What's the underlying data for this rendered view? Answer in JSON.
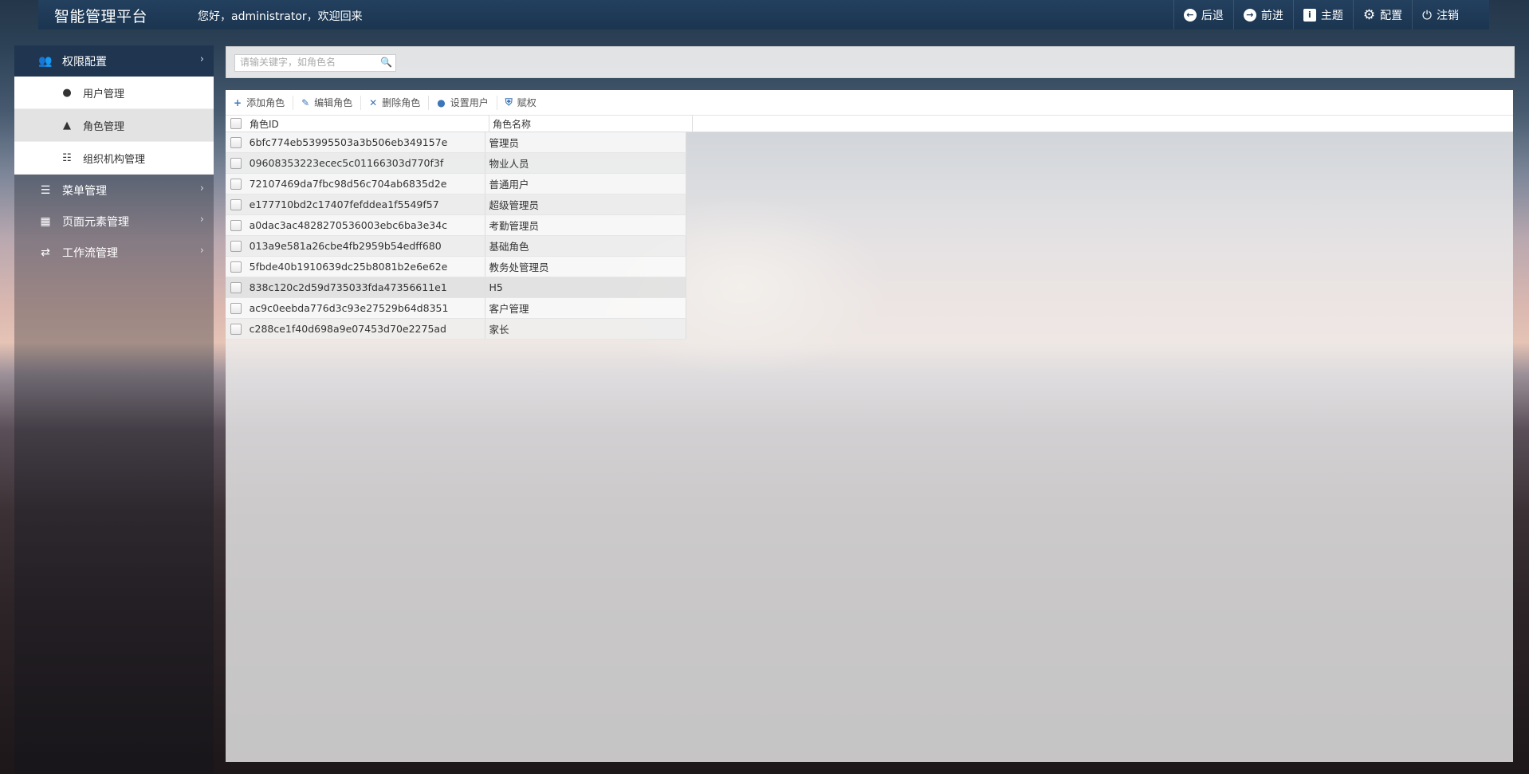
{
  "app": {
    "brand": "智能管理平台",
    "welcome": "您好，administrator，欢迎回来"
  },
  "top_actions": [
    {
      "label": "后退",
      "icon": "arrow-left-circle-icon"
    },
    {
      "label": "前进",
      "icon": "arrow-right-circle-icon"
    },
    {
      "label": "主题",
      "icon": "theme-icon"
    },
    {
      "label": "配置",
      "icon": "gear-icon"
    },
    {
      "label": "注销",
      "icon": "power-icon"
    }
  ],
  "sidebar": {
    "groups": [
      {
        "label": "权限配置",
        "icon": "users-icon",
        "expanded": true
      },
      {
        "label": "菜单管理",
        "icon": "list-icon"
      },
      {
        "label": "页面元素管理",
        "icon": "grid-icon"
      },
      {
        "label": "工作流管理",
        "icon": "shuffle-icon"
      }
    ],
    "sub_items": [
      {
        "label": "用户管理",
        "icon": "user-icon"
      },
      {
        "label": "角色管理",
        "icon": "graduation-cap-icon",
        "active": true
      },
      {
        "label": "组织机构管理",
        "icon": "sitemap-icon"
      }
    ]
  },
  "search": {
    "placeholder": "请输关键字，如角色名",
    "value": ""
  },
  "toolbar": [
    {
      "label": "添加角色",
      "icon": "plus-icon"
    },
    {
      "label": "编辑角色",
      "icon": "pencil-icon"
    },
    {
      "label": "删除角色",
      "icon": "times-icon"
    },
    {
      "label": "设置用户",
      "icon": "user-icon"
    },
    {
      "label": "赋权",
      "icon": "shield-icon"
    }
  ],
  "grid": {
    "columns": [
      "角色ID",
      "角色名称"
    ],
    "rows": [
      {
        "id": "6bfc774eb53995503a3b506eb349157e",
        "name": "管理员"
      },
      {
        "id": "09608353223ecec5c01166303d770f3f",
        "name": "物业人员"
      },
      {
        "id": "72107469da7fbc98d56c704ab6835d2e",
        "name": "普通用户"
      },
      {
        "id": "e177710bd2c17407fefddea1f5549f57",
        "name": "超级管理员"
      },
      {
        "id": "a0dac3ac4828270536003ebc6ba3e34c",
        "name": "考勤管理员"
      },
      {
        "id": "013a9e581a26cbe4fb2959b54edff680",
        "name": "基础角色"
      },
      {
        "id": "5fbde40b1910639dc25b8081b2e6e62e",
        "name": "教务处管理员"
      },
      {
        "id": "838c120c2d59d735033fda47356611e1",
        "name": "H5"
      },
      {
        "id": "ac9c0eebda776d3c93e27529b64d8351",
        "name": "客户管理"
      },
      {
        "id": "c288ce1f40d698a9e07453d70e2275ad",
        "name": "家长"
      }
    ]
  },
  "colors": {
    "topbar": "#1b3550",
    "active_group": "#1f3550",
    "toolbar_icon": "#3a76b8"
  }
}
